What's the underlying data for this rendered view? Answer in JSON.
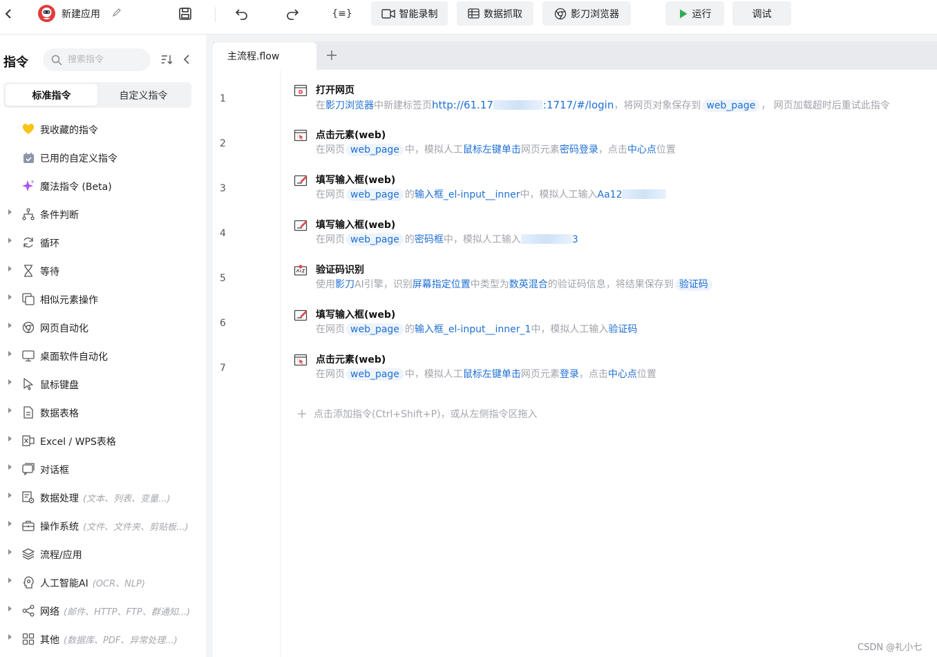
{
  "toolbar": {
    "app_name": "新建应用",
    "record_label": "智能录制",
    "scrape_label": "数据抓取",
    "browser_label": "影刀浏览器",
    "run_label": "运行",
    "debug_label": "调试",
    "accent_color": "#2fae57"
  },
  "sidebar": {
    "title": "指令",
    "search_placeholder": "搜索指令",
    "seg_standard": "标准指令",
    "seg_custom": "自定义指令",
    "items": [
      {
        "label": "我收藏的指令",
        "hint": "",
        "icon": "heart-icon",
        "expandable": false
      },
      {
        "label": "已用的自定义指令",
        "hint": "",
        "icon": "calendar-icon",
        "expandable": false
      },
      {
        "label": "魔法指令 (Beta)",
        "hint": "",
        "icon": "sparkle-icon",
        "expandable": false
      },
      {
        "label": "条件判断",
        "hint": "",
        "icon": "branch-icon",
        "expandable": true
      },
      {
        "label": "循环",
        "hint": "",
        "icon": "loop-icon",
        "expandable": true
      },
      {
        "label": "等待",
        "hint": "",
        "icon": "hourglass-icon",
        "expandable": true
      },
      {
        "label": "相似元素操作",
        "hint": "",
        "icon": "copy-icon",
        "expandable": true
      },
      {
        "label": "网页自动化",
        "hint": "",
        "icon": "chrome-icon",
        "expandable": true
      },
      {
        "label": "桌面软件自动化",
        "hint": "",
        "icon": "monitor-icon",
        "expandable": true
      },
      {
        "label": "鼠标键盘",
        "hint": "",
        "icon": "cursor-icon",
        "expandable": true
      },
      {
        "label": "数据表格",
        "hint": "",
        "icon": "document-icon",
        "expandable": true
      },
      {
        "label": "Excel / WPS表格",
        "hint": "",
        "icon": "excel-icon",
        "expandable": true
      },
      {
        "label": "对话框",
        "hint": "",
        "icon": "dialog-icon",
        "expandable": true
      },
      {
        "label": "数据处理",
        "hint": "(文本、列表、变量...)",
        "icon": "data-process-icon",
        "expandable": true
      },
      {
        "label": "操作系统",
        "hint": "(文件、文件夹、剪贴板...)",
        "icon": "briefcase-icon",
        "expandable": true
      },
      {
        "label": "流程/应用",
        "hint": "",
        "icon": "layers-icon",
        "expandable": true
      },
      {
        "label": "人工智能AI",
        "hint": "(OCR、NLP)",
        "icon": "ai-brain-icon",
        "expandable": true
      },
      {
        "label": "网络",
        "hint": "(邮件、HTTP、FTP、群通知...)",
        "icon": "share-icon",
        "expandable": true
      },
      {
        "label": "其他",
        "hint": "(数据库、PDF、异常处理...)",
        "icon": "grid-icon",
        "expandable": true
      }
    ]
  },
  "tabs": [
    {
      "label": "主流程.flow"
    }
  ],
  "flow": {
    "line_numbers": [
      "1",
      "2",
      "3",
      "4",
      "5",
      "6",
      "7"
    ],
    "steps": [
      {
        "title": "打开网页",
        "icon": "open-webpage-icon",
        "desc": {
          "a": "在",
          "b": "影刀浏览器",
          "c": "中新建标签页",
          "d": "http://61.17",
          "e": ":1717/#/login",
          "f": "，将网页对象保存到",
          "g": "web_page",
          "h": "， 网页加载超时后重试此指令"
        }
      },
      {
        "title": "点击元素(web)",
        "icon": "click-element-icon",
        "desc": {
          "a": "在网页",
          "b": "web_page",
          "c": "中，模拟人工",
          "d": "鼠标左键单击",
          "e": "网页元素",
          "f": "密码登录",
          "g": "，点击",
          "h": "中心点",
          "i": "位置"
        }
      },
      {
        "title": "填写输入框(web)",
        "icon": "fill-input-icon",
        "desc": {
          "a": "在网页",
          "b": "web_page",
          "c": "的",
          "d": "输入框_el-input__inner",
          "e": "中，模拟人工输入",
          "f": "Aa12"
        }
      },
      {
        "title": "填写输入框(web)",
        "icon": "fill-input-icon",
        "desc": {
          "a": "在网页",
          "b": "web_page",
          "c": "的",
          "d": "密码框",
          "e": "中，模拟人工输入",
          "f": "3"
        }
      },
      {
        "title": "验证码识别",
        "icon": "captcha-icon",
        "desc": {
          "a": "使用",
          "b": "影刀",
          "c": "AI引擎，识别",
          "d": "屏幕指定位置",
          "e": "中类型为",
          "f": "数英混合",
          "g": "的验证码信息，将结果保存到",
          "h": "验证码"
        }
      },
      {
        "title": "填写输入框(web)",
        "icon": "fill-input-icon",
        "desc": {
          "a": "在网页",
          "b": "web_page",
          "c": "的",
          "d": "输入框_el-input__inner_1",
          "e": "中，模拟人工输入",
          "f": "验证码"
        }
      },
      {
        "title": "点击元素(web)",
        "icon": "click-element-icon",
        "desc": {
          "a": "在网页",
          "b": "web_page",
          "c": "中，模拟人工",
          "d": "鼠标左键单击",
          "e": "网页元素",
          "f": "登录",
          "g": "，点击",
          "h": "中心点",
          "i": "位置"
        }
      }
    ],
    "add_hint": "点击添加指令(Ctrl+Shift+P)，或从左侧指令区拖入"
  },
  "watermark": "CSDN @礼小七"
}
